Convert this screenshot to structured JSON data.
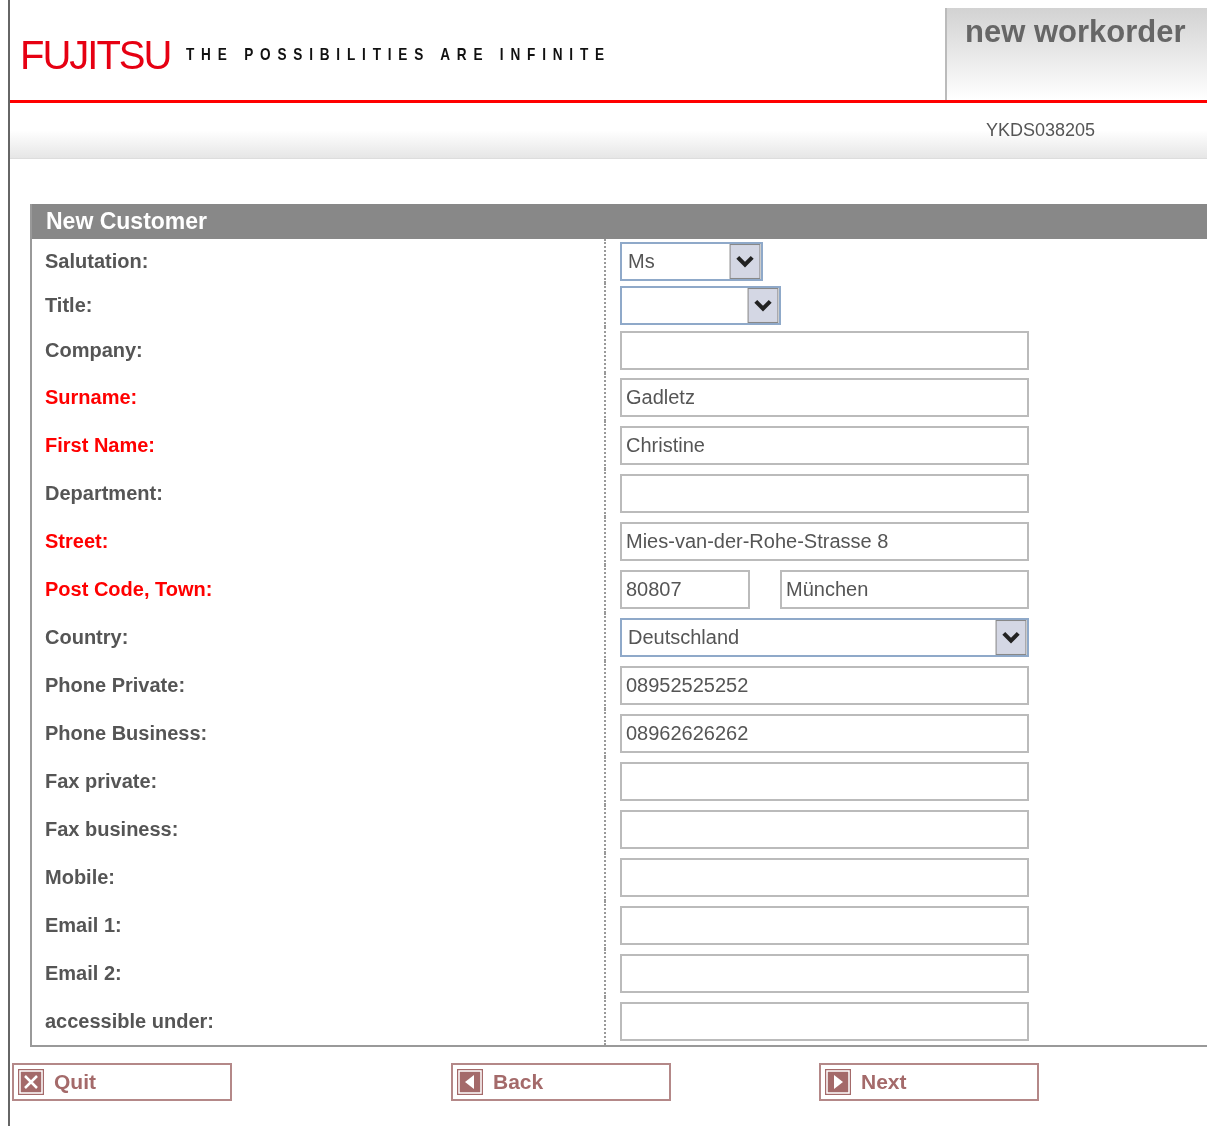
{
  "header": {
    "logo": "FUJITSU",
    "tagline": "THE POSSIBILITIES ARE INFINITE",
    "page_title": "new workorder",
    "reference": "YKDS038205"
  },
  "form": {
    "title": "New Customer",
    "fields": [
      {
        "label": "Salutation:",
        "required": false,
        "kind": "select",
        "value": "Ms"
      },
      {
        "label": "Title:",
        "required": false,
        "kind": "select"
      },
      {
        "label": "Company:",
        "required": false,
        "kind": "text"
      },
      {
        "label": "Surname:",
        "required": true,
        "kind": "text",
        "value": "Gadletz"
      },
      {
        "label": "First Name:",
        "required": true,
        "kind": "text",
        "value": "Christine"
      },
      {
        "label": "Department:",
        "required": false,
        "kind": "text"
      },
      {
        "label": "Street:",
        "required": true,
        "kind": "text",
        "value": "Mies-van-der-Rohe-Strasse 8"
      },
      {
        "label": "Post Code, Town:",
        "required": true,
        "kind": "pair",
        "value": "80807",
        "value_2": "München"
      },
      {
        "label": "Country:",
        "required": false,
        "kind": "select-wide",
        "value": "Deutschland"
      },
      {
        "label": "Phone Private:",
        "required": false,
        "kind": "text",
        "value": "08952525252"
      },
      {
        "label": "Phone Business:",
        "required": false,
        "kind": "text",
        "value": "08962626262"
      },
      {
        "label": "Fax private:",
        "required": false,
        "kind": "text"
      },
      {
        "label": "Fax business:",
        "required": false,
        "kind": "text"
      },
      {
        "label": "Mobile:",
        "required": false,
        "kind": "text"
      },
      {
        "label": "Email 1:",
        "required": false,
        "kind": "text"
      },
      {
        "label": "Email 2:",
        "required": false,
        "kind": "text"
      },
      {
        "label": "accessible under:",
        "required": false,
        "kind": "text"
      }
    ]
  },
  "buttons": [
    {
      "label": "Quit",
      "kind": "quit"
    },
    {
      "label": "Back",
      "kind": "back"
    },
    {
      "label": "Next",
      "kind": "next"
    }
  ]
}
